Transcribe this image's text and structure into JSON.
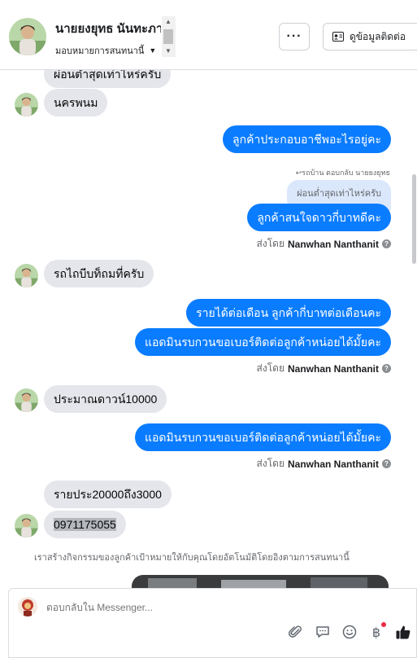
{
  "header": {
    "contact_name": "นายยงยุทธ นันทะภา",
    "assign_label": "มอบหมายการสนทนานี้",
    "more_label": "···",
    "contact_info_label": "ดูข้อมูลติดต่อ"
  },
  "messages": {
    "in_top_partial": "ผ่อนต่ำสุดเท่าไหร่ครับ",
    "in_1": "นครพนม",
    "out_1": "ลูกค้าประกอบอาชีพอะไรอยู่คะ",
    "reply_meta": "↩รถบ้าน ตอบกลับ นายยงยุทธ",
    "quoted": "ผ่อนต่ำสุดเท่าไหร่ครับ",
    "out_2": "ลูกค้าสนใจดาวกี่บาทดีคะ",
    "sent_by_prefix": "ส่งโดย",
    "sent_by_name": "Nanwhan Nanthanit",
    "in_2": "รถไถบีบท็ถมที่ครับ",
    "out_3": "รายได้ต่อเดือน ลูกค้ากี่บาทต่อเดือนคะ",
    "out_4": "แอดมินรบกวนขอเบอร์ติดต่อลูกค้าหน่อยได้มั้ยคะ",
    "in_3": "ประมาณดาวน์10000",
    "out_5": "แอดมินรบกวนขอเบอร์ติดต่อลูกค้าหน่อยได้มั้ยคะ",
    "in_4": "รายประ20000ถึง3000",
    "in_5": "0971175055",
    "system_note": "เราสร้างกิจกรรมของลูกค้าเป้าหมายให้กับคุณโดยอัตโนมัติโดยอิงตามการสนทนานี้"
  },
  "composer": {
    "placeholder": "ตอบกลับใน Messenger..."
  },
  "icons": {
    "attach": "paperclip-icon",
    "message": "message-icon",
    "emoji": "emoji-icon",
    "payment": "baht-icon",
    "like": "thumbs-up-icon"
  },
  "colors": {
    "outgoing": "#0a7cff",
    "incoming": "#e4e6eb",
    "like": "#1c1e21",
    "notification": "#f02849"
  }
}
